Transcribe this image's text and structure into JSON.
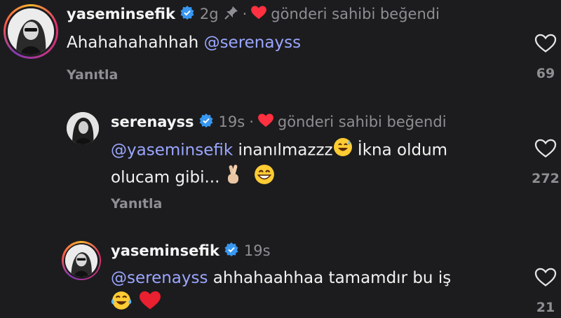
{
  "comments": [
    {
      "username": "yaseminsefik",
      "time": "2g",
      "pinned": true,
      "liked_label": "gönderi sahibi beğendi",
      "mention": "@serenayss",
      "text_before": "Ahahahahahhah",
      "reply_label": "Yanıtla",
      "like_count": "69"
    },
    {
      "username": "serenayss",
      "time": "19s",
      "liked_label": "gönderi sahibi beğendi",
      "mention": "@yaseminsefik",
      "text_line1": "inanılmazzz",
      "text_line1b": "İkna oldum",
      "text_line2": "olucam gibi...",
      "reply_label": "Yanıtla",
      "like_count": "272"
    },
    {
      "username": "yaseminsefik",
      "time": "19s",
      "mention": "@serenayss",
      "text": "ahhahaahhaa tamamdır bu iş",
      "like_count": "21"
    }
  ],
  "icons": {
    "verified": "verified-badge-icon",
    "pin": "pin-icon",
    "heart_red": "heart-filled-icon",
    "heart_outline": "heart-outline-icon",
    "emoji_sweat": "grinning-sweat-emoji",
    "emoji_fingers": "crossed-fingers-emoji",
    "emoji_grin": "beaming-face-emoji",
    "emoji_tears": "tears-of-joy-emoji",
    "emoji_heart": "red-heart-emoji"
  },
  "colors": {
    "background": "#1c1c1e",
    "mention": "#9aa6ff",
    "verified": "#3897f0",
    "heart": "#ff3040",
    "muted": "#8e8e93"
  }
}
